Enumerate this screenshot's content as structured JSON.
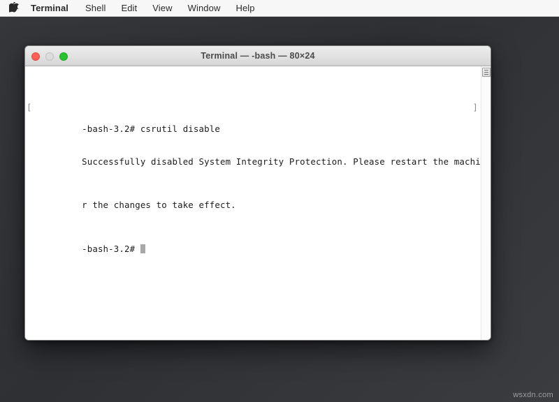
{
  "menubar": {
    "apple_icon": "apple-logo-icon",
    "items": [
      {
        "label": "Terminal",
        "active": true
      },
      {
        "label": "Shell",
        "active": false
      },
      {
        "label": "Edit",
        "active": false
      },
      {
        "label": "View",
        "active": false
      },
      {
        "label": "Window",
        "active": false
      },
      {
        "label": "Help",
        "active": false
      }
    ]
  },
  "window": {
    "title": "Terminal — -bash — 80×24",
    "controls": {
      "close_label": "close-button",
      "minimize_label": "minimize-button",
      "zoom_label": "zoom-button"
    },
    "scrollbar": {
      "thumb_label": "scroll-thumb"
    }
  },
  "terminal": {
    "prompt_mark_open": "[",
    "prompt_mark_close": "]",
    "lines": [
      "-bash-3.2# csrutil disable",
      "Successfully disabled System Integrity Protection. Please restart the machine fo",
      "r the changes to take effect.",
      "-bash-3.2# "
    ]
  },
  "watermark": {
    "text": "wsxdn.com"
  },
  "colors": {
    "desktop_bg": "#2f3135",
    "menubar_bg": "#f7f7f7",
    "titlebar_bg": "#e3e3e3",
    "terminal_bg": "#ffffff",
    "terminal_fg": "#1c1c1c",
    "close": "#ff6159",
    "minimize": "#dcdcdc",
    "zoom": "#2ac230",
    "cursor": "#a8a8a8"
  }
}
